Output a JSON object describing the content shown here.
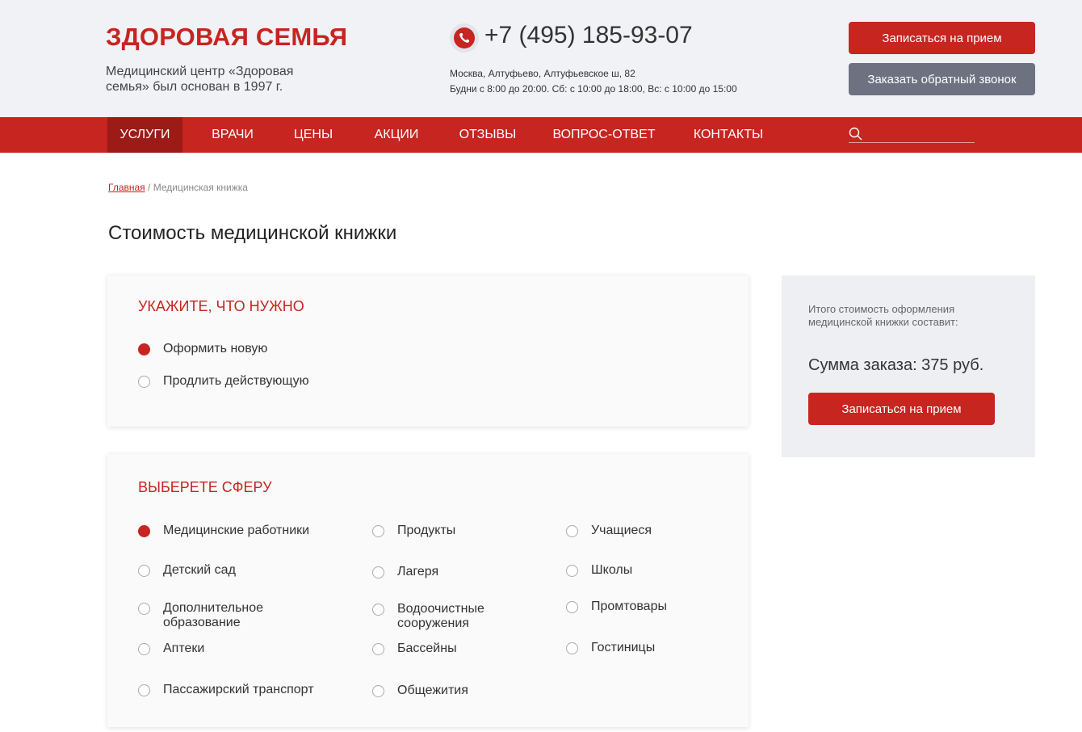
{
  "header": {
    "logo": "ЗДОРОВАЯ СЕМЬЯ",
    "tagline": "Медицинский центр «Здоровая семья» был основан в 1997 г.",
    "phone": "+7 (495) 185-93-07",
    "address": "Москва, Алтуфьево, Алтуфьевское ш, 82",
    "hours": "Будни с 8:00 до 20:00. Сб: с 10:00 до 18:00,  Вс: с 10:00 до 15:00",
    "appointment_button": "Записаться на прием",
    "callback_button": "Заказать обратный звонок"
  },
  "nav": {
    "items": [
      {
        "label": "УСЛУГИ",
        "active": true
      },
      {
        "label": "ВРАЧИ",
        "active": false
      },
      {
        "label": "ЦЕНЫ",
        "active": false
      },
      {
        "label": "АКЦИИ",
        "active": false
      },
      {
        "label": "ОТЗЫВЫ",
        "active": false
      },
      {
        "label": "ВОПРОС-ОТВЕТ",
        "active": false
      },
      {
        "label": "КОНТАКТЫ",
        "active": false
      }
    ],
    "search_value": ""
  },
  "breadcrumb": {
    "home": "Главная",
    "separator": " / ",
    "current": "Медицинская книжка"
  },
  "page_title": "Стоимость медицинской книжки",
  "need_section": {
    "title": "УКАЖИТЕ, ЧТО НУЖНО",
    "options": [
      {
        "label": "Оформить новую",
        "checked": true
      },
      {
        "label": "Продлить действующую",
        "checked": false
      }
    ]
  },
  "sphere_section": {
    "title": "ВЫБЕРЕТЕ СФЕРУ",
    "options": [
      {
        "label": "Медицинские работники",
        "checked": true
      },
      {
        "label": "Продукты",
        "checked": false
      },
      {
        "label": "Учащиеся",
        "checked": false
      },
      {
        "label": "Детский сад",
        "checked": false
      },
      {
        "label": "Лагеря",
        "checked": false
      },
      {
        "label": "Школы",
        "checked": false
      },
      {
        "label": "Дополнительное образование",
        "checked": false
      },
      {
        "label": "Водоочистные сооружения",
        "checked": false
      },
      {
        "label": "Промтовары",
        "checked": false
      },
      {
        "label": "Аптеки",
        "checked": false
      },
      {
        "label": "Бассейны",
        "checked": false
      },
      {
        "label": "Гостиницы",
        "checked": false
      },
      {
        "label": "Пассажирский транспорт",
        "checked": false
      },
      {
        "label": "Общежития",
        "checked": false
      }
    ]
  },
  "summary": {
    "label": "Итого стоимость оформления медицинской книжки составит:",
    "total": "Сумма заказа: 375 руб.",
    "button": "Записаться на прием"
  },
  "colors": {
    "brand_red": "#c62520",
    "nav_active": "#9c1b17",
    "gray_button": "#6c7280"
  }
}
